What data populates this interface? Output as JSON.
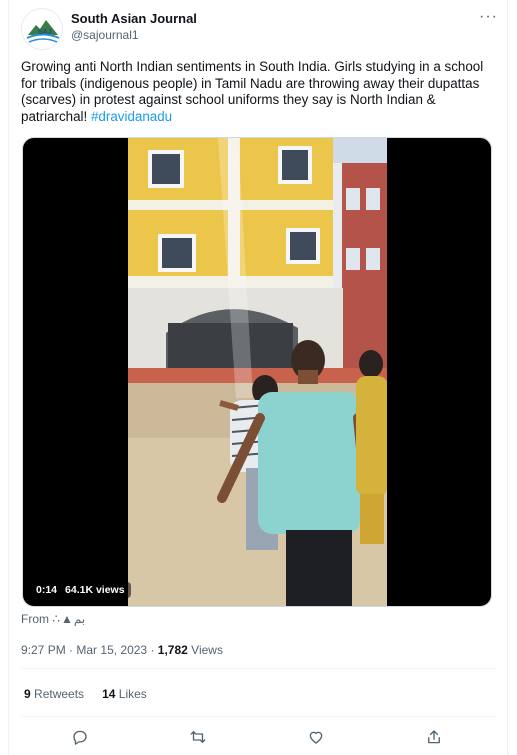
{
  "account": {
    "name": "South Asian Journal",
    "handle": "@sajournal1",
    "more_label": "···"
  },
  "tweet": {
    "text": "Growing anti North Indian sentiments in South India. Girls studying in a school for tribals (indigenous people) in Tamil Nadu are throwing away their dupattas (scarves) in protest against school uniforms they say is North Indian & patriarchal! ",
    "hashtag": "#dravidanadu"
  },
  "video": {
    "time": "0:14",
    "views": "64.1K views"
  },
  "source": {
    "prefix": "From",
    "label": "∴▲بم"
  },
  "meta": {
    "time": "9:27 PM",
    "separator": "·",
    "date": "Mar 15, 2023",
    "views_count": "1,782",
    "views_label": "Views"
  },
  "stats": {
    "retweets_count": "9",
    "retweets_label": "Retweets",
    "likes_count": "14",
    "likes_label": "Likes"
  },
  "actions": [
    "reply-icon",
    "retweet-icon",
    "like-icon",
    "share-icon"
  ],
  "colors": {
    "link": "#1d9bf0",
    "secondary_text": "#536471",
    "primary_text": "#0f1419",
    "building_yellow": "#f2c744"
  }
}
